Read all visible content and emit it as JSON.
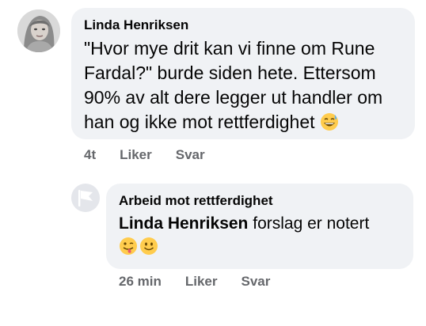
{
  "comment": {
    "author": "Linda Henriksen",
    "text": "\"Hvor mye drit kan vi finne om Rune Fardal?\" burde siden hete. Ettersom 90% av alt dere legger ut handler om han og ikke mot rettferdighet",
    "emoji": "grinning-sweat",
    "actions": {
      "time": "4t",
      "like": "Liker",
      "reply": "Svar"
    }
  },
  "reply": {
    "author": "Arbeid mot rettferdighet",
    "mention": "Linda Henriksen",
    "text": "forslag er notert",
    "emojis": [
      "tongue-wink",
      "smile"
    ],
    "actions": {
      "time": "26 min",
      "like": "Liker",
      "reply": "Svar"
    }
  },
  "colors": {
    "bubble": "#f0f2f5",
    "meta": "#65676b",
    "emoji": "#ffcc4d"
  }
}
